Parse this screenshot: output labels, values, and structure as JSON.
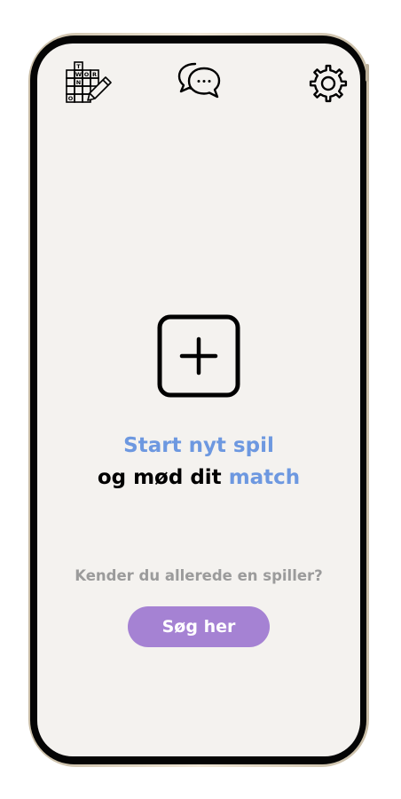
{
  "app": {
    "colors": {
      "accent_blue": "#6d98e0",
      "button_purple": "#a582d3",
      "screen_background": "#f4f2ef",
      "muted_text": "#9b9b9b"
    }
  },
  "header": {
    "left_icon": "crossword-pencil-icon",
    "center_icon": "chat-bubbles-icon",
    "right_icon": "gear-icon",
    "crossword_letters": [
      "T",
      "W",
      "O",
      "R",
      "N",
      "O"
    ]
  },
  "main": {
    "new_game_icon": "plus-square-icon",
    "headline_line1": "Start nyt spil",
    "headline_line2_prefix": "og mød dit ",
    "headline_line2_accent": "match",
    "question": "Kender du allerede en spiller?",
    "search_button_label": "Søg her"
  }
}
